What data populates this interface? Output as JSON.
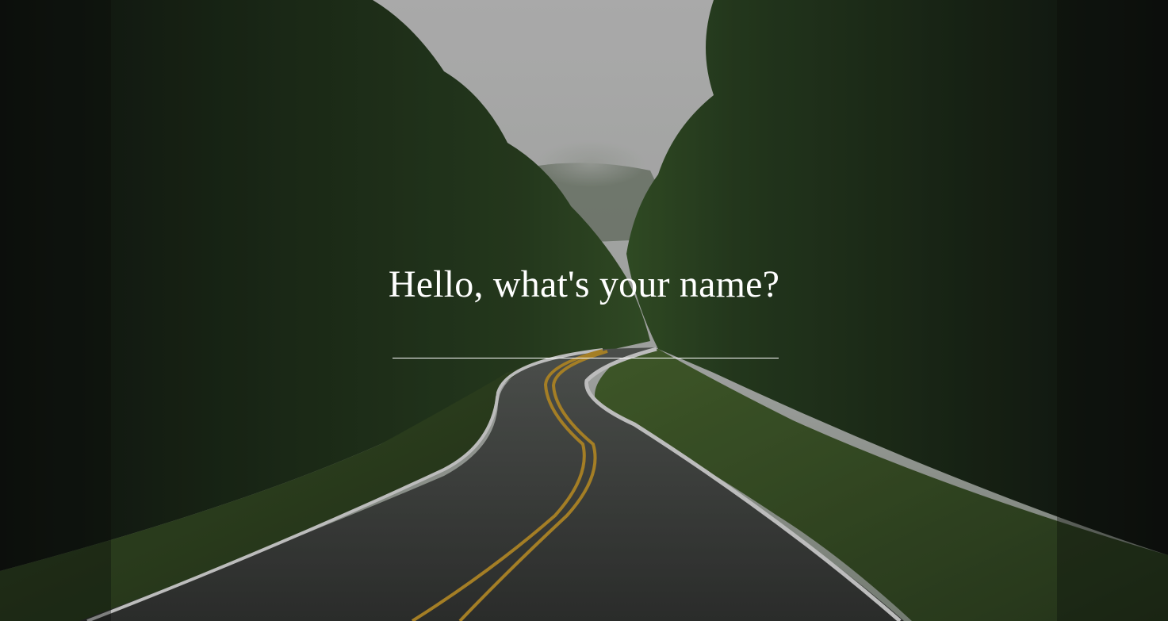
{
  "greeting": {
    "question": "Hello, what's your name?"
  },
  "name_input": {
    "value": "",
    "placeholder": ""
  },
  "background": {
    "scene": "forest-road-photo",
    "colors": {
      "sky": "#cfd0cf",
      "foliage_dark": "#1b2a18",
      "foliage_mid": "#2f4a25",
      "grass": "#4e6b33",
      "road": "#3c3e3c",
      "center_line": "#c99a2e",
      "edge_line": "#e6e6e6"
    }
  }
}
